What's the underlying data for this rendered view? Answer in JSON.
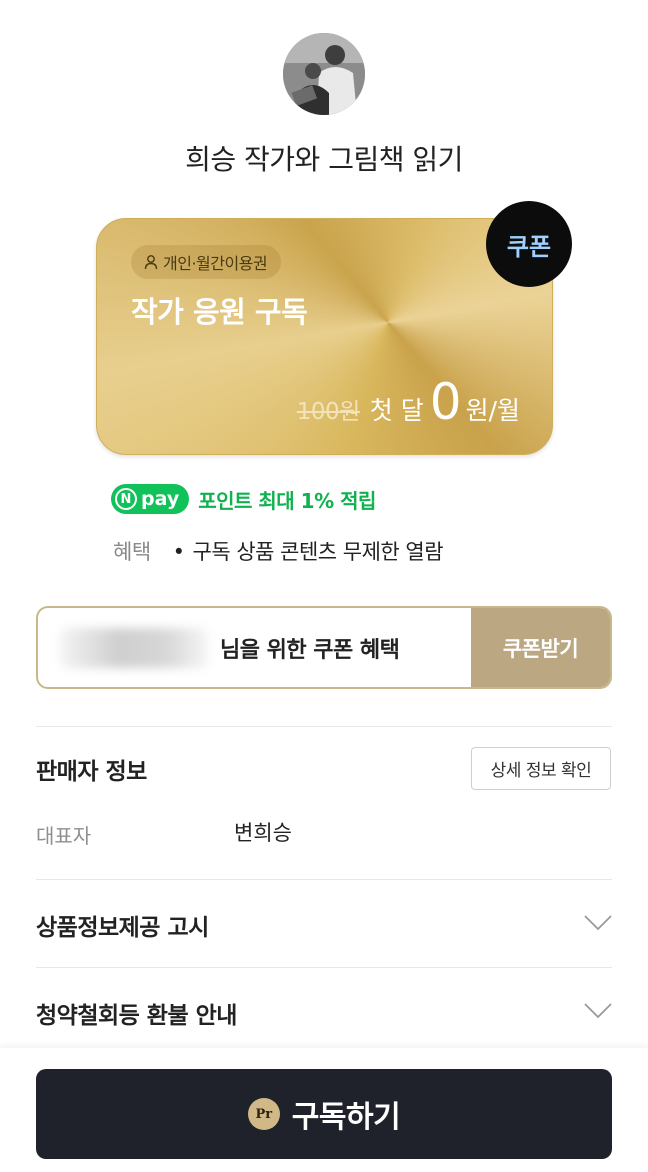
{
  "header": {
    "title": "희승 작가와 그림책 읽기",
    "avatar_icon": "profile-photo"
  },
  "card": {
    "badge_label": "개인·월간이용권",
    "badge_icon": "person-icon",
    "title": "작가 응원 구독",
    "old_price": "100원",
    "first_month": "첫 달",
    "price": "0",
    "per_month": "원/월",
    "coupon_tag": "쿠폰",
    "colors": {
      "gold": "#d9b85e",
      "coupon_text": "#9fd0ff"
    }
  },
  "npay": {
    "logo_n": "N",
    "logo_text": "pay",
    "points": "포인트 최대 1% 적립",
    "color": "#11c15a"
  },
  "benefit": {
    "label": "혜택",
    "item": "구독 상품 콘텐츠 무제한 열람"
  },
  "coupon": {
    "text": "님을 위한 쿠폰 혜택",
    "button": "쿠폰받기"
  },
  "seller": {
    "title": "판매자 정보",
    "detail_button": "상세 정보 확인",
    "rep_label": "대표자",
    "rep_value": "변희승"
  },
  "sections": [
    {
      "title": "상품정보제공 고시",
      "icon": "chevron-down-icon"
    },
    {
      "title": "청약철회등 환불 안내",
      "icon": "chevron-down-icon"
    }
  ],
  "cta": {
    "icon_text": "Pr",
    "label": "구독하기",
    "color": "#1f222b"
  }
}
